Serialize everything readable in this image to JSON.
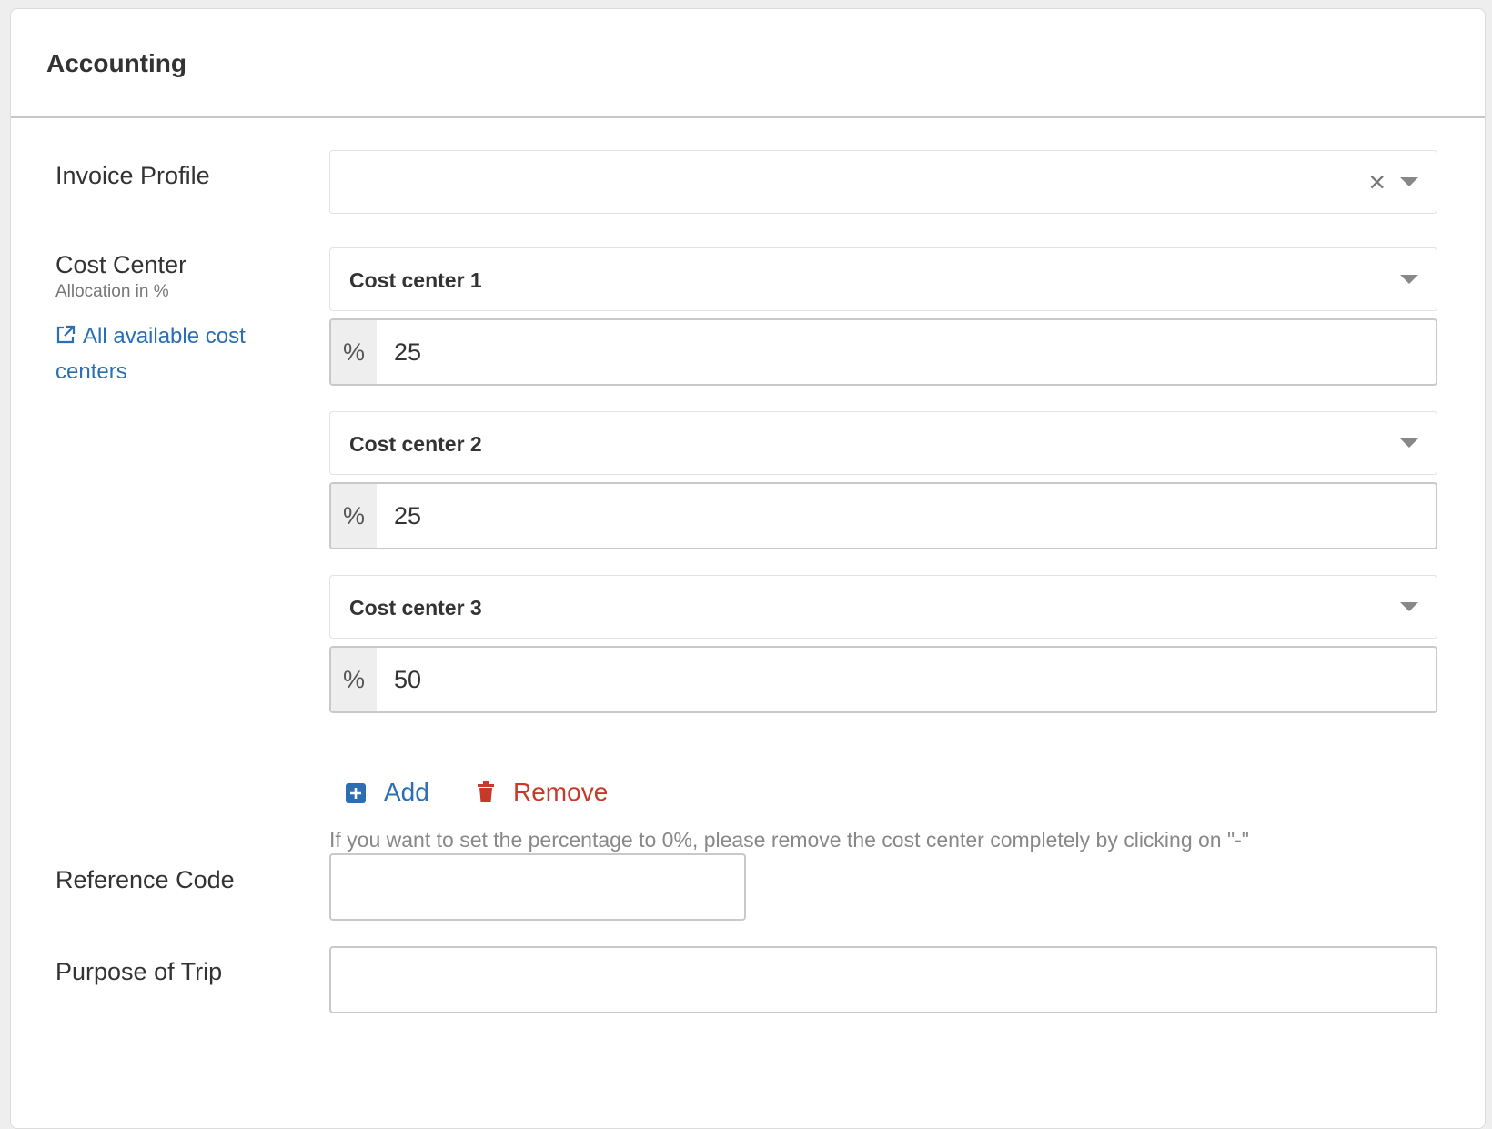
{
  "panel": {
    "title": "Accounting"
  },
  "invoice_profile": {
    "label": "Invoice Profile",
    "value": ""
  },
  "cost_center": {
    "label": "Cost Center",
    "sublabel": "Allocation in %",
    "link_label": "All available cost centers",
    "percent_symbol": "%",
    "items": [
      {
        "name": "Cost center 1",
        "percent": "25"
      },
      {
        "name": "Cost center 2",
        "percent": "25"
      },
      {
        "name": "Cost center 3",
        "percent": "50"
      }
    ],
    "add_label": "Add",
    "remove_label": "Remove",
    "help_text": "If you want to set the percentage to 0%, please remove the cost center completely by clicking on \"-\""
  },
  "reference_code": {
    "label": "Reference Code",
    "value": ""
  },
  "purpose_of_trip": {
    "label": "Purpose of Trip",
    "value": ""
  },
  "colors": {
    "link": "#2a6eb3",
    "danger": "#c9392a",
    "muted": "#888888"
  },
  "icons": {
    "clear": "×",
    "external_link": "external-link-icon",
    "add": "plus-square-icon",
    "remove": "trash-icon",
    "dropdown": "caret-down-icon"
  }
}
